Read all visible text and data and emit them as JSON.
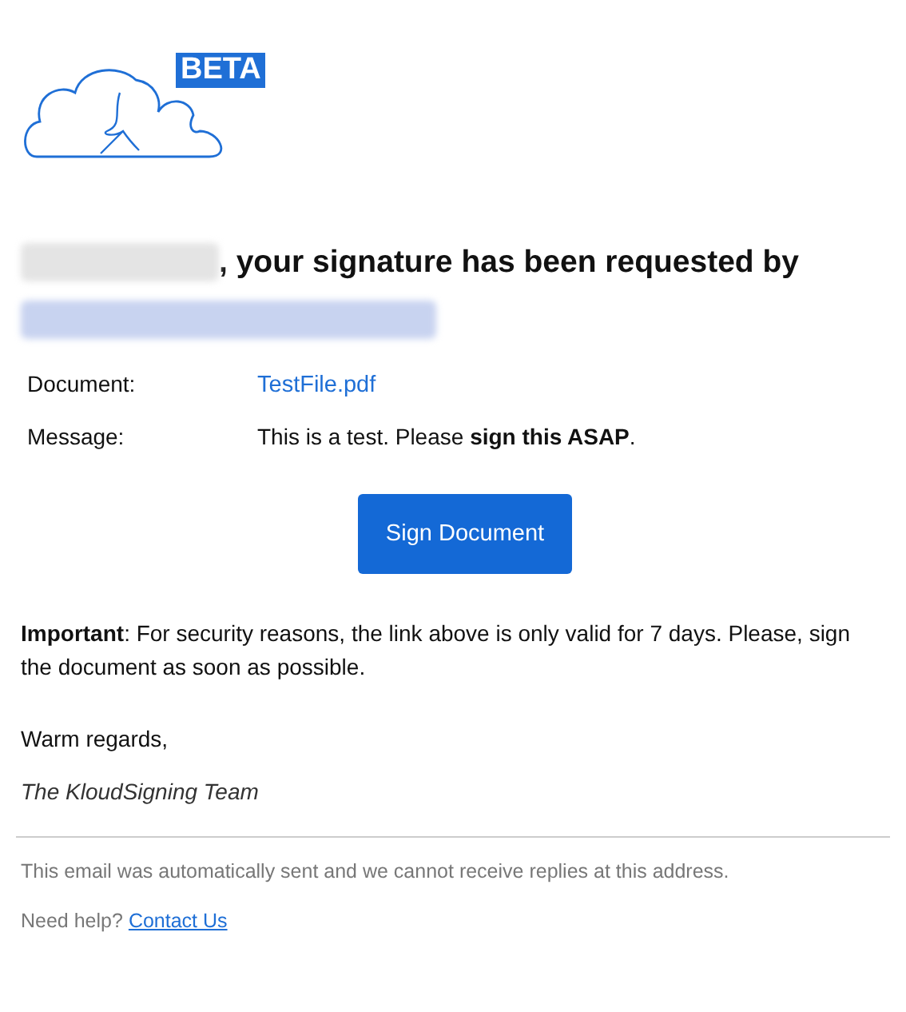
{
  "logo": {
    "badge": "BETA"
  },
  "heading": {
    "text": ", your signature has been requested by"
  },
  "details": [
    {
      "label": "Document:",
      "value": "TestFile.pdf",
      "kind": "link"
    },
    {
      "label": "Message:",
      "value": "This is a test. Please **sign this ASAP**.",
      "kind": "text"
    }
  ],
  "button": "Sign Document",
  "notice": "**Important**: For security reasons, the link above is only valid for 7 days. Please, sign the document as soon as possible.",
  "closing": "Warm regards,",
  "signature": "The KloudSigning Team",
  "footer": {
    "note": "This email was automatically sent and we cannot receive replies at this address.",
    "help": "Need help?",
    "link": "Contact Us"
  }
}
